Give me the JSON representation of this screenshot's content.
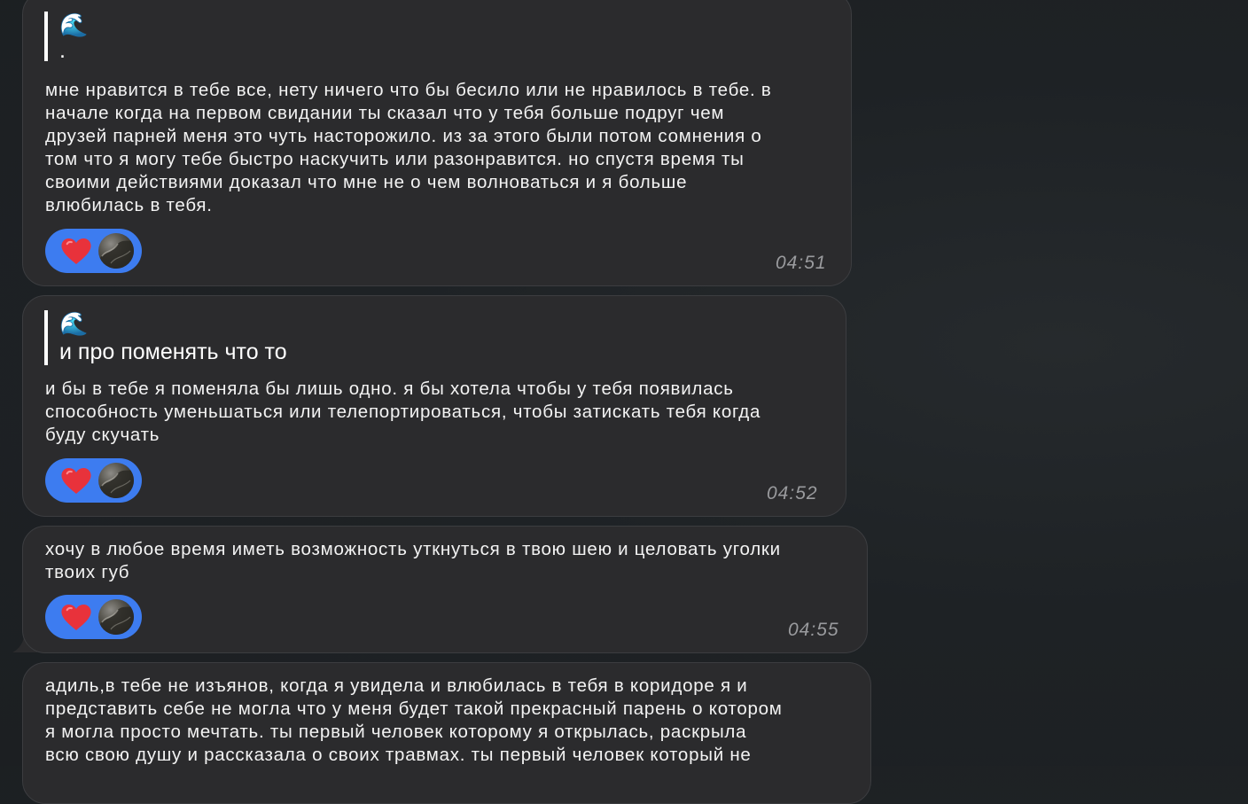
{
  "messages": [
    {
      "quote": {
        "emoji": "🌊",
        "text": "."
      },
      "text": "мне нравится в тебе все, нету ничего что бы бесило или не нравилось в тебе. в\nначале когда на первом свидании ты сказал что у тебя больше подруг чем\nдрузей парней меня это чуть насторожило. из за этого были потом сомнения о\nтом что я могу тебе быстро наскучить или разонравится. но спустя время ты\nсвоими действиями доказал что мне не о чем волноваться и я больше\nвлюбилась в тебя.",
      "reaction": "❤️",
      "time": "04:51"
    },
    {
      "quote": {
        "emoji": "🌊",
        "text": "и про поменять что то"
      },
      "text": "и бы в тебе я поменяла бы лишь одно. я бы хотела чтобы у тебя появилась\nспособность уменьшаться или телепортироваться, чтобы затискать тебя когда\nбуду скучать",
      "reaction": "❤️",
      "time": "04:52"
    },
    {
      "text": "хочу в любое время иметь возможность уткнуться в твою шею и целовать уголки\nтвоих губ",
      "reaction": "❤️",
      "time": "04:55"
    },
    {
      "text": "адиль,в тебе не изъянов, когда я увидела и влюбилась в тебя в коридоре я и\nпредставить себе не могла что у меня будет такой прекрасный парень о котором\nя могла просто мечтать. ты первый человек которому я открылась, раскрыла\nвсю свою душу и рассказала о своих травмах. ты первый человек который не"
    }
  ],
  "colors": {
    "bubble": "#2b2b2d",
    "reaction_pill": "#3d7cf0",
    "heart": "#e8323b",
    "time": "#9a9b9e"
  }
}
